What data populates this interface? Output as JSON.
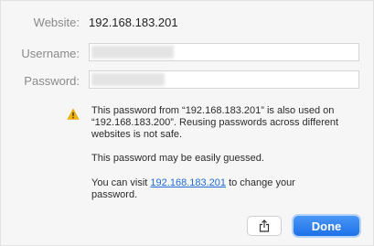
{
  "website": {
    "label": "Website:",
    "value": "192.168.183.201"
  },
  "username": {
    "label": "Username:"
  },
  "password": {
    "label": "Password:"
  },
  "warning": {
    "line1": "This password from “192.168.183.201” is also used on",
    "line2": "“192.168.183.200”. Reusing passwords across different",
    "line3": "websites is not safe.",
    "guess": "This password may be easily guessed.",
    "visit_prefix": "You can visit ",
    "visit_link": "192.168.183.201",
    "visit_suffix": " to change your",
    "visit_line2": "password."
  },
  "buttons": {
    "done_label": "Done",
    "share_icon": "share-icon"
  },
  "colors": {
    "accent": "#1e71e8",
    "warning": "#f2b705",
    "link": "#1f6ad6"
  }
}
